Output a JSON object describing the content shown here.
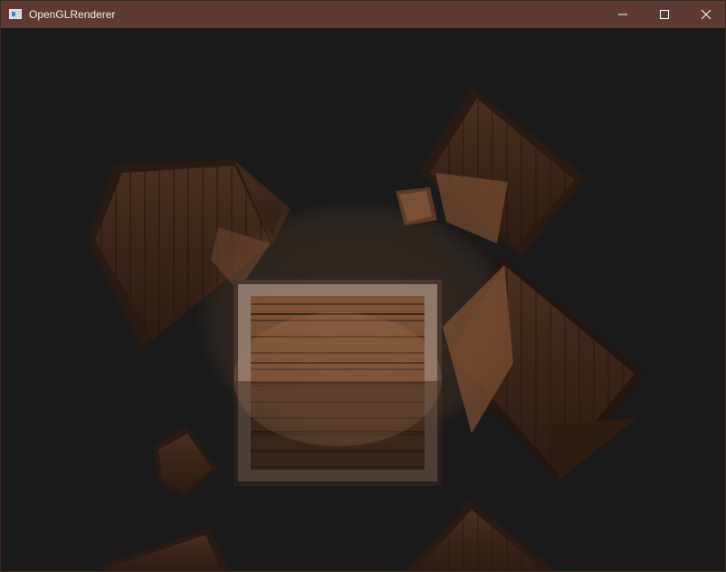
{
  "window": {
    "title": "OpenGLRenderer",
    "icon": "app-window-icon",
    "controls": {
      "minimize": "minimize-icon",
      "maximize": "maximize-icon",
      "close": "close-icon"
    },
    "titlebar_color": "#5e3a33"
  },
  "scene": {
    "description_icon": "rendered-3d-scene",
    "background_color": "#1a1a1a",
    "crate_color": "#5a3a26",
    "highlight_color": "#8a5a38"
  }
}
